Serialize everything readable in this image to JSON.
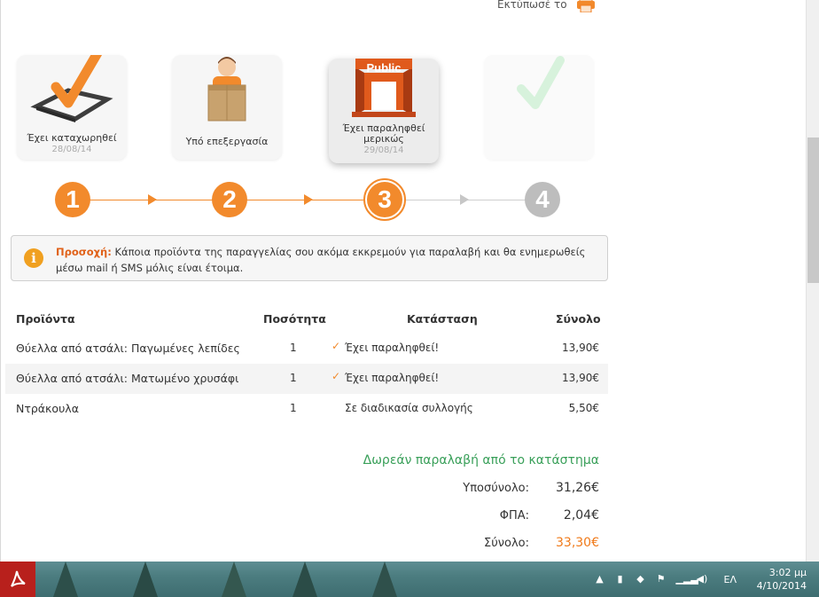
{
  "print": {
    "label": "Εκτύπωσέ το",
    "icon": "printer-icon"
  },
  "steps": [
    {
      "label": "Έχει καταχωρηθεί",
      "date": "28/08/14",
      "icon": "checkbox-check-icon",
      "number": "1"
    },
    {
      "label": "Υπό επεξεργασία",
      "date": "",
      "icon": "courier-box-icon",
      "number": "2"
    },
    {
      "label": "Έχει παραληφθεί μερικώς",
      "date": "29/08/14",
      "icon": "store-icon",
      "store_sign": "Public",
      "number": "3"
    },
    {
      "label": "",
      "date": "",
      "icon": "check-icon",
      "number": "4"
    }
  ],
  "notice": {
    "title": "Προσοχή:",
    "text": "Κάποια προϊόντα της παραγγελίας σου ακόμα εκκρεμούν για παραλαβή και θα ενημερωθείς μέσω mail ή SMS μόλις είναι έτοιμα."
  },
  "table": {
    "headers": {
      "product": "Προϊόντα",
      "quantity": "Ποσότητα",
      "status": "Κατάσταση",
      "total": "Σύνολο"
    },
    "rows": [
      {
        "product": "Θύελλα από ατσάλι: Παγωμένες λεπίδες",
        "quantity": "1",
        "status": "Έχει παραληφθεί!",
        "total": "13,90€",
        "checked": true
      },
      {
        "product": "Θύελλα από ατσάλι: Ματωμένο χρυσάφι",
        "quantity": "1",
        "status": "Έχει παραληφθεί!",
        "total": "13,90€",
        "checked": true
      },
      {
        "product": "Ντράκουλα",
        "quantity": "1",
        "status": "Σε διαδικασία συλλογής",
        "total": "5,50€",
        "checked": false
      }
    ]
  },
  "totals": {
    "free_pickup": "Δωρεάν παραλαβή από το κατάστημα",
    "subtotal_label": "Υποσύνολο:",
    "subtotal": "31,26€",
    "vat_label": "ΦΠΑ:",
    "vat": "2,04€",
    "total_label": "Σύνολο:",
    "total": "33,30€"
  },
  "taskbar": {
    "language": "ΕΛ",
    "time": "3:02 μμ",
    "date": "4/10/2014"
  },
  "colors": {
    "accent": "#f28a2c",
    "green": "#3aa05a",
    "gray_step": "#bdbdbd"
  }
}
